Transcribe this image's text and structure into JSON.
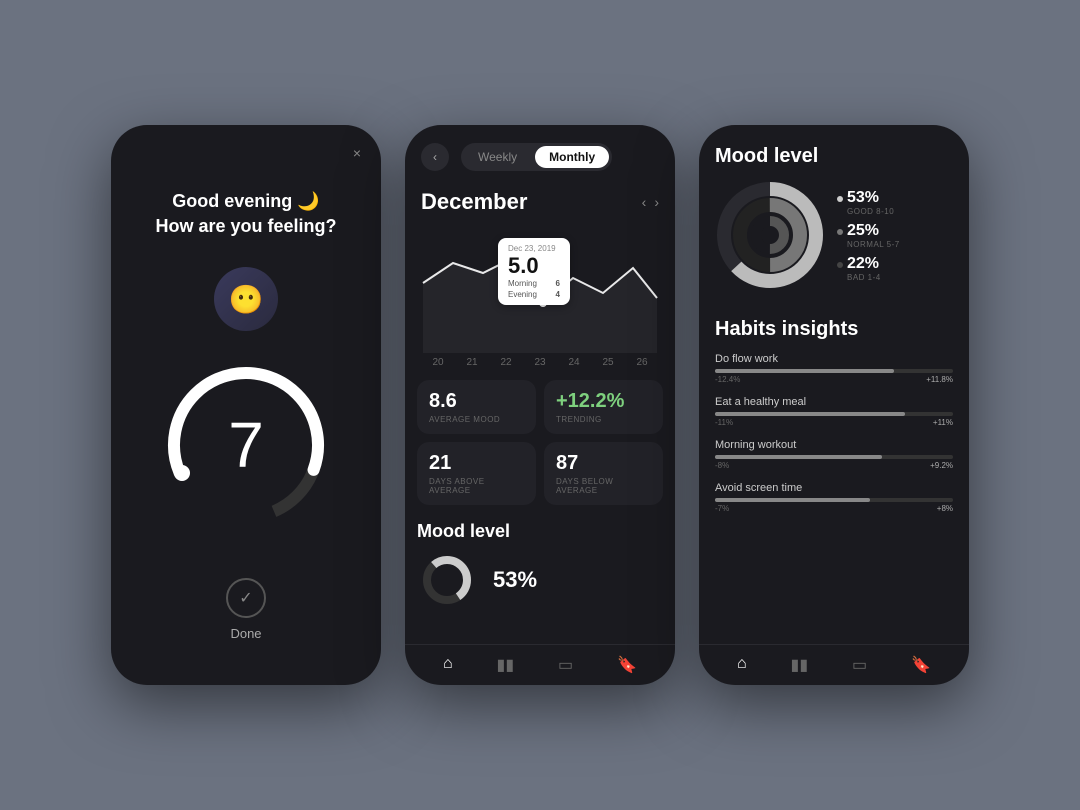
{
  "background": "#6b7280",
  "phone1": {
    "greeting_line1": "Good evening 🌙",
    "greeting_line2": "How are you feeling?",
    "dial_value": "7",
    "close_icon": "×",
    "done_label": "Done",
    "check_icon": "✓"
  },
  "phone2": {
    "back_icon": "‹",
    "tabs": [
      {
        "label": "Weekly",
        "active": false
      },
      {
        "label": "Monthly",
        "active": true
      }
    ],
    "month": "December",
    "tooltip": {
      "date": "Dec 23, 2019",
      "value": "5.0",
      "morning_label": "Morning",
      "morning_val": "6",
      "evening_label": "Evening",
      "evening_val": "4"
    },
    "chart_dates": [
      "20",
      "21",
      "22",
      "23",
      "24",
      "25",
      "26"
    ],
    "stats": [
      {
        "value": "8.6",
        "label": "AVERAGE MOOD"
      },
      {
        "value": "+12.2%",
        "label": "TRENDING"
      },
      {
        "value": "21",
        "label": "DAYS ABOVE AVERAGE"
      },
      {
        "value": "87",
        "label": "DAYS BELOW AVERAGE"
      }
    ],
    "mood_section_title": "Mood level",
    "mood_pct": "53%",
    "nav_icons": [
      "⌂",
      "▮▮",
      "▭",
      "🔖"
    ]
  },
  "phone3": {
    "mood_title": "Mood level",
    "mood_levels": [
      {
        "pct": "53%",
        "label": "GOOD 8-10"
      },
      {
        "pct": "25%",
        "label": "NORMAL 5-7"
      },
      {
        "pct": "22%",
        "label": "BAD 1-4"
      }
    ],
    "habits_title": "Habits insights",
    "habits": [
      {
        "name": "Do flow work",
        "neg": "-12.4%",
        "pos": "+11.8%",
        "fill_pct": 75
      },
      {
        "name": "Eat a healthy meal",
        "neg": "-11%",
        "pos": "+11%",
        "fill_pct": 80
      },
      {
        "name": "Morning workout",
        "neg": "-8%",
        "pos": "+9.2%",
        "fill_pct": 70
      },
      {
        "name": "Avoid screen time",
        "neg": "-7%",
        "pos": "+8%",
        "fill_pct": 65
      }
    ],
    "nav_icons": [
      "⌂",
      "▮▮",
      "▭",
      "🔖"
    ]
  }
}
